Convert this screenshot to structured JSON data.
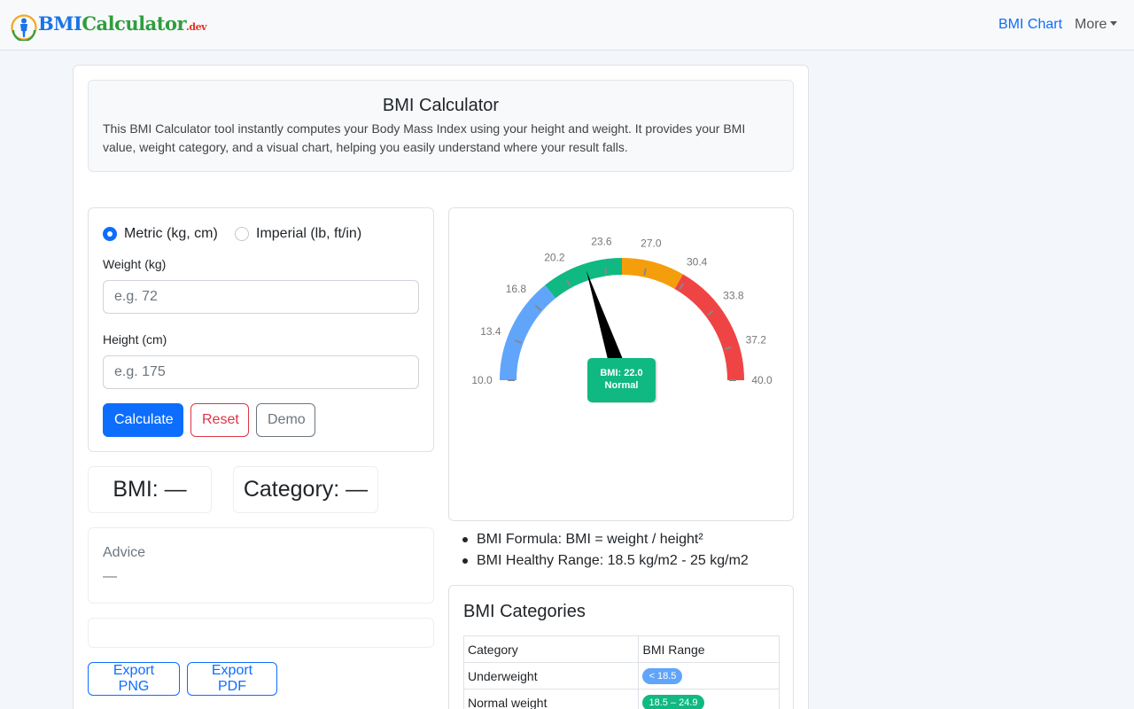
{
  "navbar": {
    "brand": {
      "part1": "BMI",
      "part2": "Calculator",
      "part3": ".dev"
    },
    "links": {
      "chart": "BMI Chart",
      "more": "More"
    }
  },
  "intro": {
    "title": "BMI Calculator",
    "text": "This BMI Calculator tool instantly computes your Body Mass Index using your height and weight. It provides your BMI value, weight category, and a visual chart, helping you easily understand where your result falls."
  },
  "form": {
    "unit_options": {
      "metric": "Metric (kg, cm)",
      "imperial": "Imperial (lb, ft/in)"
    },
    "selected_unit": "metric",
    "weight": {
      "label": "Weight (kg)",
      "placeholder": "e.g. 72",
      "value": ""
    },
    "height": {
      "label": "Height (cm)",
      "placeholder": "e.g. 175",
      "value": ""
    },
    "buttons": {
      "calculate": "Calculate",
      "reset": "Reset",
      "demo": "Demo"
    }
  },
  "results": {
    "bmi": "BMI: —",
    "category": "Category: —"
  },
  "advice": {
    "title": "Advice",
    "text": "—"
  },
  "export": {
    "png": "Export PNG",
    "pdf": "Export PDF"
  },
  "gauge": {
    "min": 10.0,
    "max": 40.0,
    "tick_labels": [
      "10.0",
      "13.4",
      "16.8",
      "20.2",
      "23.6",
      "27.0",
      "30.4",
      "33.8",
      "37.2",
      "40.0"
    ],
    "segments": [
      {
        "from": 10.0,
        "to": 18.5,
        "color": "#60a5fa"
      },
      {
        "from": 18.5,
        "to": 25.0,
        "color": "#10b981"
      },
      {
        "from": 25.0,
        "to": 30.0,
        "color": "#f59e0b"
      },
      {
        "from": 30.0,
        "to": 40.0,
        "color": "#ef4444"
      }
    ],
    "value": 22.0,
    "bubble_line1": "BMI: 22.0",
    "bubble_line2": "Normal",
    "bubble_color": "#10b981"
  },
  "info": {
    "formula": "BMI Formula: BMI = weight / height²",
    "healthy_range": "BMI Healthy Range: 18.5 kg/m2 - 25 kg/m2"
  },
  "categories": {
    "title": "BMI Categories",
    "headers": [
      "Category",
      "BMI Range"
    ],
    "rows": [
      {
        "category": "Underweight",
        "range": "< 18.5",
        "color": "#60a5fa"
      },
      {
        "category": "Normal weight",
        "range": "18.5 – 24.9",
        "color": "#10b981"
      }
    ]
  }
}
